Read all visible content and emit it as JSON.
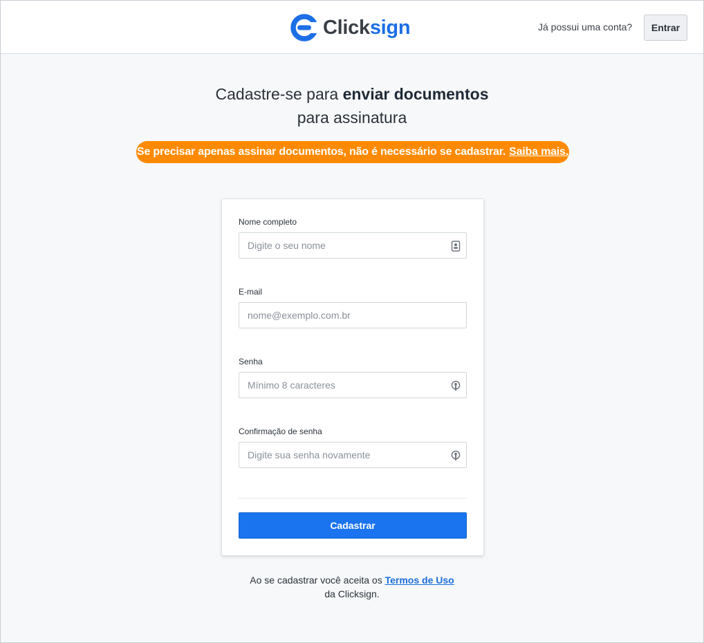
{
  "header": {
    "brand_part1": "Click",
    "brand_part2": "sign",
    "has_account_text": "Já possui uma conta?",
    "enter_label": "Entrar"
  },
  "hero": {
    "title_prefix": "Cadastre-se para ",
    "title_bold": "enviar documentos",
    "title_line2": "para assinatura"
  },
  "banner": {
    "text": "Se precisar apenas assinar documentos, não é necessário se cadastrar.",
    "link_label": "Saiba mais."
  },
  "form": {
    "name_label": "Nome completo",
    "name_placeholder": "Digite o seu nome",
    "email_label": "E-mail",
    "email_placeholder": "nome@exemplo.com.br",
    "password_label": "Senha",
    "password_placeholder": "Mínimo 8 caracteres",
    "confirm_label": "Confirmação de senha",
    "confirm_placeholder": "Digite sua senha novamente",
    "submit_label": "Cadastrar"
  },
  "terms": {
    "prefix": "Ao se cadastrar você aceita os ",
    "link_label": "Termos de Uso",
    "suffix": "da Clicksign."
  },
  "icons": {
    "name_field": "contact-card-icon",
    "password_field": "key-icon",
    "confirm_field": "key-icon"
  },
  "colors": {
    "brand_blue": "#1c6fe6",
    "banner_orange": "#ff8a00",
    "primary_button": "#1a74f0"
  }
}
